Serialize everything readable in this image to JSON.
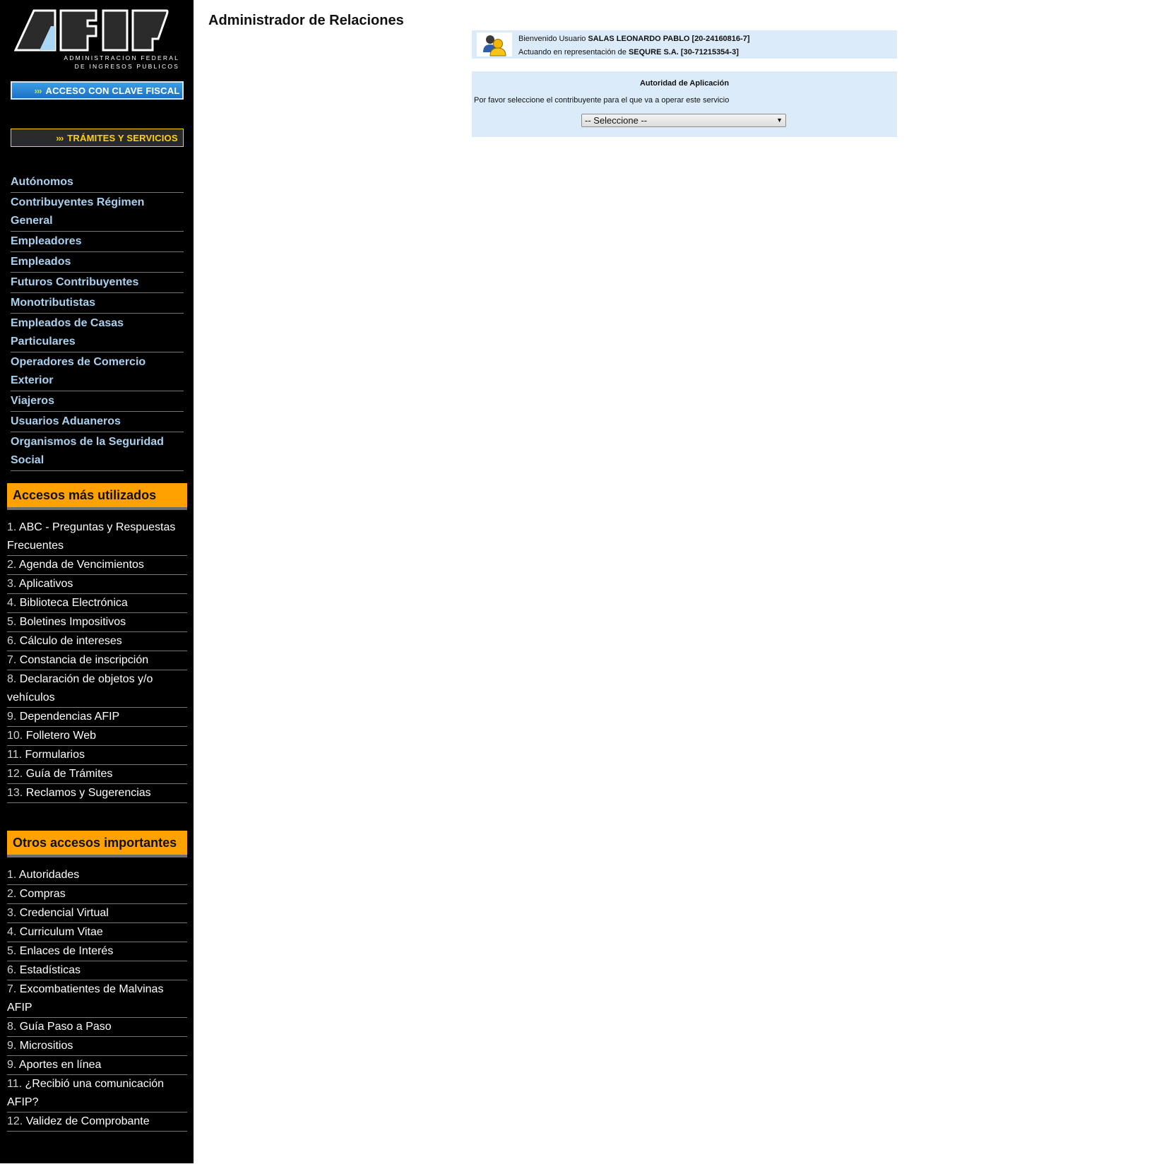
{
  "logo": {
    "line1": "ADMINISTRACION FEDERAL",
    "line2": "DE INGRESOS PUBLICOS"
  },
  "banners": {
    "clave_fiscal": {
      "arrows": "›››",
      "label": "ACCESO CON CLAVE FISCAL"
    },
    "tramites": {
      "arrows": "›››",
      "label": "TRÁMITES Y SERVICIOS"
    }
  },
  "nav": {
    "items": [
      {
        "label": "Autónomos"
      },
      {
        "label": "Contribuyentes Régimen General"
      },
      {
        "label": "Empleadores"
      },
      {
        "label": "Empleados"
      },
      {
        "label": "Futuros Contribuyentes"
      },
      {
        "label": "Monotributistas"
      },
      {
        "label": "Empleados de Casas Particulares"
      },
      {
        "label": "Operadores de Comercio Exterior"
      },
      {
        "label": "Viajeros"
      },
      {
        "label": "Usuarios Aduaneros"
      },
      {
        "label": "Organismos de la Seguridad Social"
      }
    ]
  },
  "accesos": {
    "title": "Accesos más utilizados",
    "items": [
      {
        "num": "1.",
        "label": "ABC - Preguntas y Respuestas Frecuentes"
      },
      {
        "num": "2.",
        "label": "Agenda de Vencimientos"
      },
      {
        "num": "3.",
        "label": "Aplicativos"
      },
      {
        "num": "4.",
        "label": "Biblioteca Electrónica"
      },
      {
        "num": "5.",
        "label": "Boletines Impositivos"
      },
      {
        "num": "6.",
        "label": "Cálculo de intereses"
      },
      {
        "num": "7.",
        "label": "Constancia de inscripción"
      },
      {
        "num": "8.",
        "label": "Declaración de objetos y/o vehículos"
      },
      {
        "num": "9.",
        "label": "Dependencias AFIP"
      },
      {
        "num": "10.",
        "label": "Folletero Web"
      },
      {
        "num": "11.",
        "label": "Formularios"
      },
      {
        "num": "12.",
        "label": "Guía de Trámites"
      },
      {
        "num": "13.",
        "label": "Reclamos y Sugerencias"
      }
    ]
  },
  "otros": {
    "title": "Otros accesos importantes",
    "items": [
      {
        "num": "1.",
        "label": "Autoridades"
      },
      {
        "num": "2.",
        "label": "Compras"
      },
      {
        "num": "3.",
        "label": "Credencial Virtual"
      },
      {
        "num": "4.",
        "label": "Curriculum Vitae"
      },
      {
        "num": "5.",
        "label": "Enlaces de Interés"
      },
      {
        "num": "6.",
        "label": "Estadísticas"
      },
      {
        "num": "7.",
        "label": "Excombatientes de Malvinas AFIP"
      },
      {
        "num": "8.",
        "label": "Guía Paso a Paso"
      },
      {
        "num": "9.",
        "label": "Micrositios"
      },
      {
        "num": "9.",
        "label": "Aportes en línea"
      },
      {
        "num": "11.",
        "label": "¿Recibió una comunicación AFIP?"
      },
      {
        "num": "12.",
        "label": "Validez de Comprobante"
      }
    ]
  },
  "main": {
    "title": "Administrador de Relaciones",
    "user": {
      "welcome_prefix": "Bienvenido Usuario",
      "name": "SALAS LEONARDO PABLO [20-24160816-7]",
      "acting_prefix": "Actuando en representación de",
      "represented": "SEQURE S.A. [30-71215354-3]"
    },
    "service": {
      "title": "Autoridad de Aplicación",
      "instructions": "Por favor seleccione el contribuyente para el que va a operar este servicio",
      "select_value": "-- Seleccione --"
    }
  },
  "colors": {
    "sidebar_bg": "#000000",
    "nav_link": "#a9d1ef",
    "section_header": "#ffa101",
    "panel_bg": "#dcebf9",
    "tramites_accent": "#ffd200",
    "clave_bg": "#1c6fc2"
  }
}
